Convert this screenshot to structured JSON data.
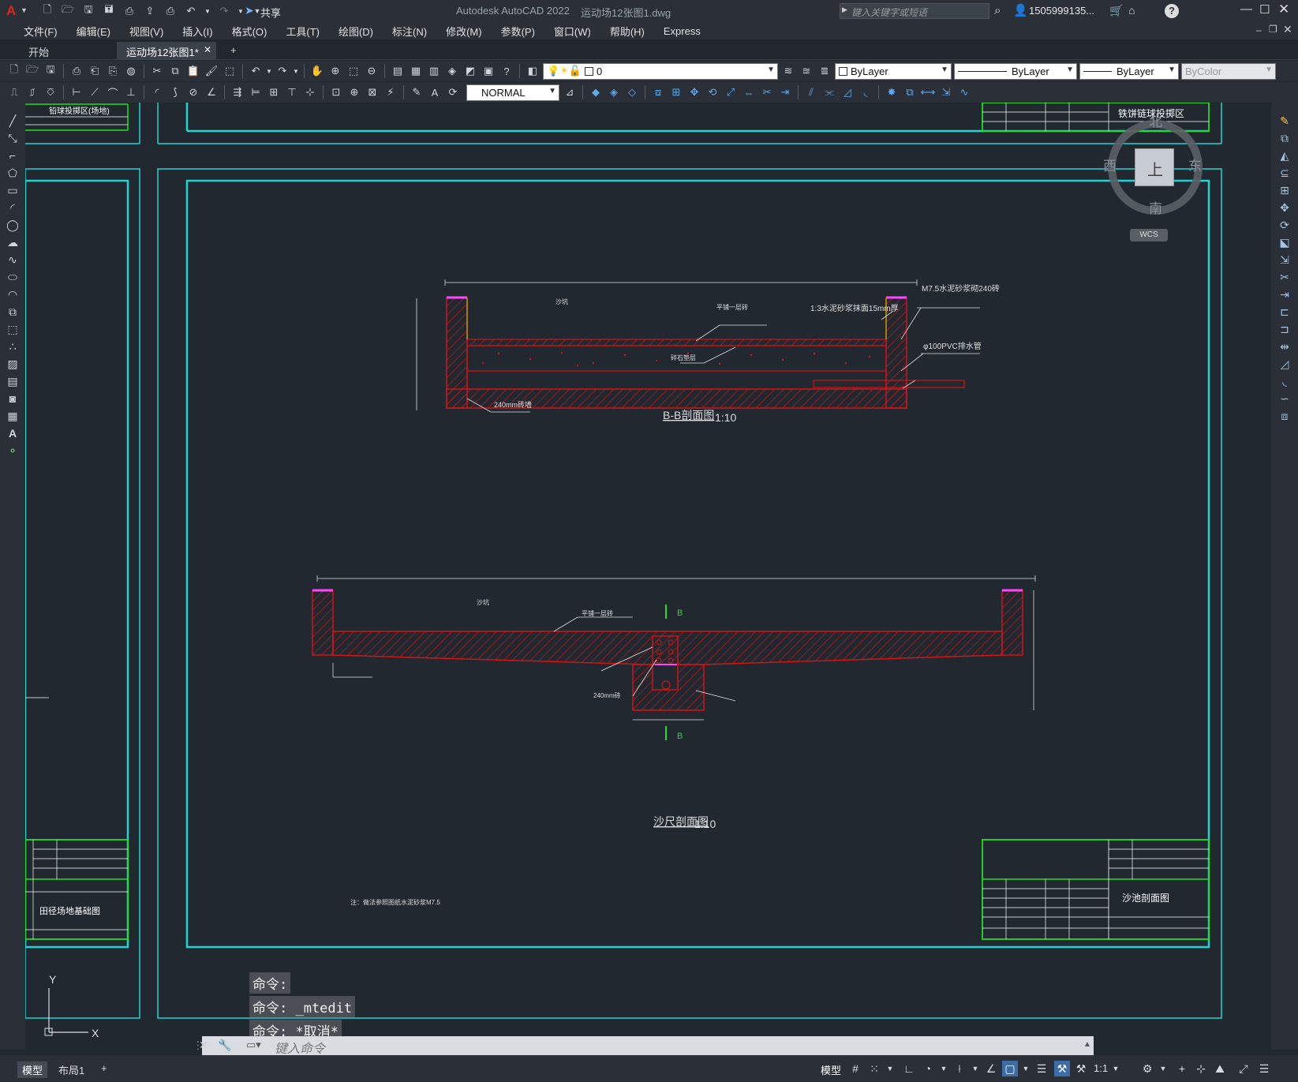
{
  "app": {
    "title": "Autodesk AutoCAD 2022",
    "filename": "运动场12张图1.dwg",
    "share_label": "共享",
    "search_placeholder": "键入关键字或短语",
    "user": "1505999135...",
    "help": "?"
  },
  "menu": [
    "文件(F)",
    "编辑(E)",
    "视图(V)",
    "插入(I)",
    "格式(O)",
    "工具(T)",
    "绘图(D)",
    "标注(N)",
    "修改(M)",
    "参数(P)",
    "窗口(W)",
    "帮助(H)",
    "Express"
  ],
  "tabs": {
    "start": "开始",
    "active": "运动场12张图1*",
    "add": "+"
  },
  "toolbar": {
    "layer_value": "0",
    "color_value": "ByLayer",
    "linetype_value": "ByLayer",
    "lineweight_value": "ByLayer",
    "plotstyle_value": "ByColor",
    "textstyle_value": "NORMAL"
  },
  "viewcube": {
    "north": "北",
    "south": "南",
    "east": "东",
    "west": "西",
    "face": "上",
    "wcs": "WCS"
  },
  "drawing": {
    "bb_title": "B-B剖面图",
    "bb_scale": "1:10",
    "sand_title": "沙尺剖面图",
    "sand_scale": "1:10",
    "label_m75": "M7.5水泥砂浆砌240砖",
    "label_plaster": "1:3水泥砂浆抹面15mm厚",
    "label_pvc": "φ100PVC排水管",
    "label_brick240": "240mm砖墙",
    "label_sand": "沙坑",
    "label_layer1": "平铺一层砖",
    "label_gravel": "碎石垫层",
    "label_240b": "240mm砖",
    "label_section_b": "B",
    "title_block_right_top": "铁饼链球投掷区",
    "title_block_right_bottom": "沙池剖面图",
    "title_block_left_bottom": "田径场地基础图",
    "title_block_left_top": "铅球投掷区(场地)",
    "note_text": "注：做法参照图纸水泥砂浆M7.5"
  },
  "command": {
    "history": [
      "命令:",
      "命令: _mtedit",
      "命令: *取消*"
    ],
    "placeholder": "键入命令"
  },
  "status": {
    "model_tab": "模型",
    "layout_tab": "布局1",
    "add": "+",
    "model_label": "模型",
    "scale": "1:1"
  }
}
